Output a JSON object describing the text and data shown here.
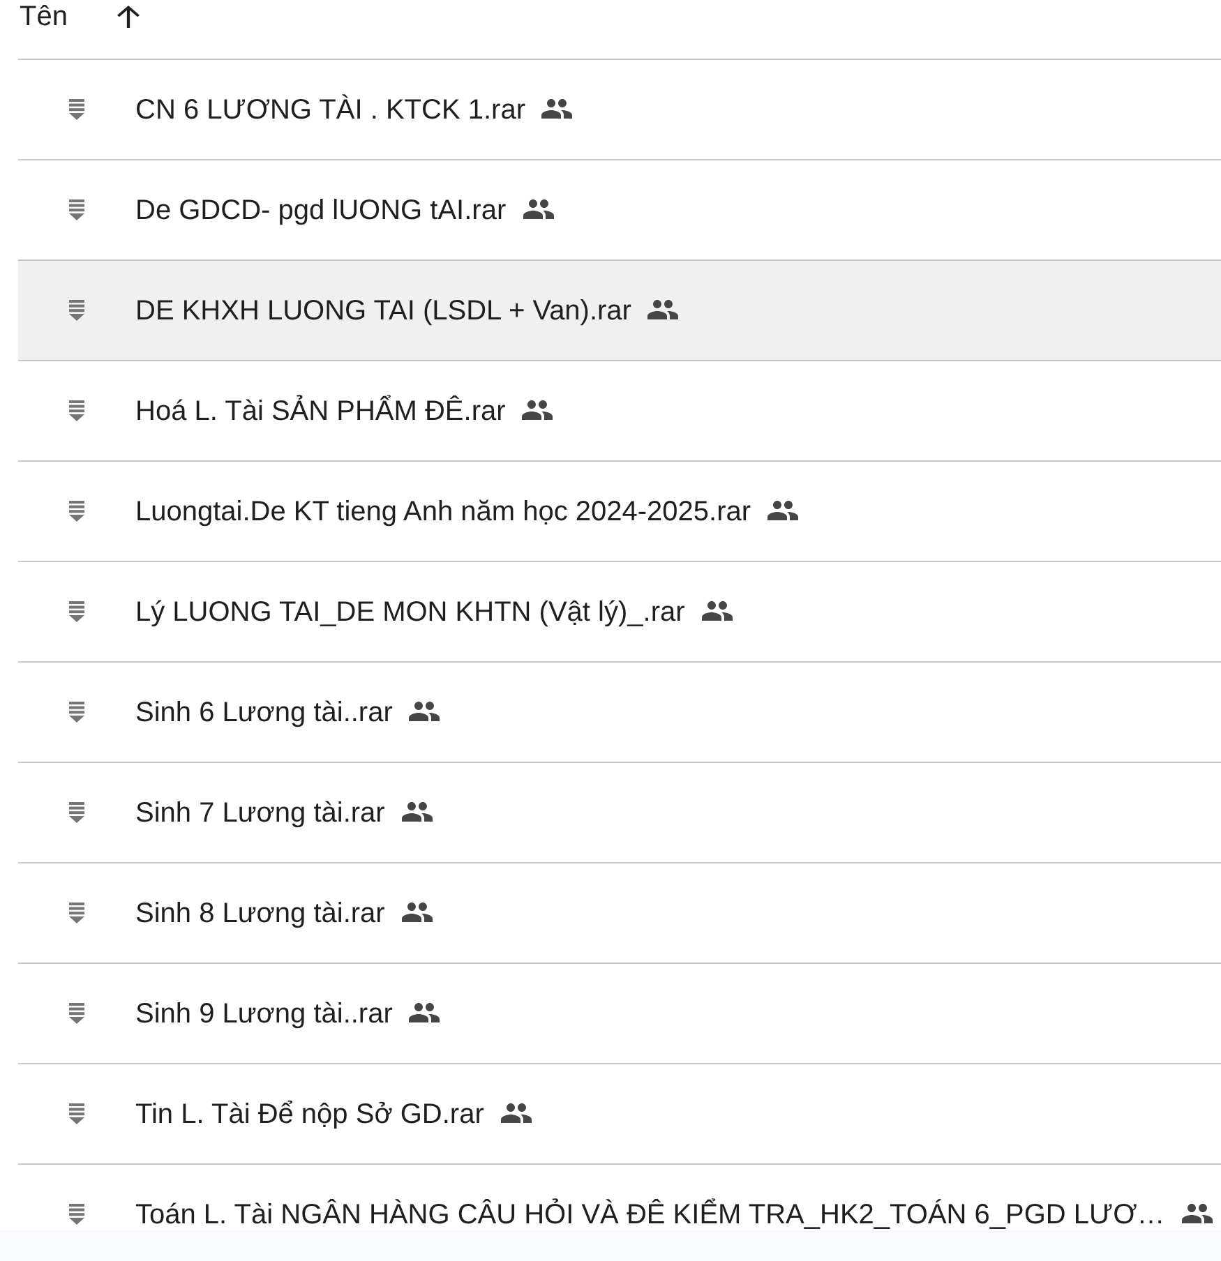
{
  "header": {
    "column_label": "Tên",
    "sort_ascending": true
  },
  "files": [
    {
      "name": "CN 6 LƯƠNG TÀI . KTCK 1.rar",
      "shared": true,
      "hovered": false
    },
    {
      "name": "De GDCD- pgd lUONG tAI.rar",
      "shared": true,
      "hovered": false
    },
    {
      "name": "DE KHXH LUONG TAI (LSDL + Van).rar",
      "shared": true,
      "hovered": true
    },
    {
      "name": "Hoá L. Tài SẢN PHẨM ĐÊ.rar",
      "shared": true,
      "hovered": false
    },
    {
      "name": "Luongtai.De KT tieng Anh năm học 2024-2025.rar",
      "shared": true,
      "hovered": false
    },
    {
      "name": "Lý LUONG TAI_DE MON KHTN (Vật lý)_.rar",
      "shared": true,
      "hovered": false
    },
    {
      "name": "Sinh 6 Lương tài..rar",
      "shared": true,
      "hovered": false
    },
    {
      "name": "Sinh 7 Lương tài.rar",
      "shared": true,
      "hovered": false
    },
    {
      "name": "Sinh 8 Lương tài.rar",
      "shared": true,
      "hovered": false
    },
    {
      "name": "Sinh 9 Lương tài..rar",
      "shared": true,
      "hovered": false
    },
    {
      "name": "Tin L. Tài Để nộp Sở GD.rar",
      "shared": true,
      "hovered": false
    },
    {
      "name": "Toán L. Tài NGÂN HÀNG CÂU HỎI VÀ ĐÊ KIỂM TRA_HK2_TOÁN 6_PGD LƯƠ…",
      "shared": true,
      "hovered": false
    }
  ]
}
